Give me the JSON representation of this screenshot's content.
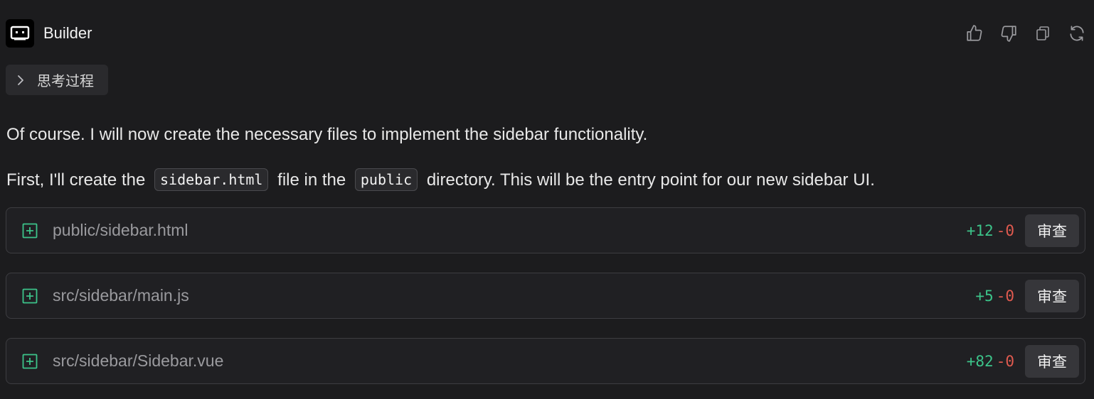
{
  "header": {
    "bot_name": "Builder",
    "actions": [
      {
        "icon": "thumbs-up-icon"
      },
      {
        "icon": "thumbs-down-icon"
      },
      {
        "icon": "copy-icon"
      },
      {
        "icon": "refresh-icon"
      }
    ]
  },
  "thinking": {
    "label": "思考过程"
  },
  "message": {
    "p1": "Of course. I will now create the necessary files to implement the sidebar functionality.",
    "p2_part1": "First, I'll create the",
    "p2_code1": "sidebar.html",
    "p2_part2": "file in the",
    "p2_code2": "public",
    "p2_part3": "directory. This will be the entry point for our new sidebar UI."
  },
  "files": [
    {
      "path": "public/sidebar.html",
      "added": "+12",
      "removed": "-0",
      "button": "审查"
    },
    {
      "path": "src/sidebar/main.js",
      "added": "+5",
      "removed": "-0",
      "button": "审查"
    },
    {
      "path": "src/sidebar/Sidebar.vue",
      "added": "+82",
      "removed": "-0",
      "button": "审查"
    }
  ],
  "colors": {
    "background": "#1c1c1e",
    "added": "#3cc48a",
    "removed": "#e05a4f"
  }
}
